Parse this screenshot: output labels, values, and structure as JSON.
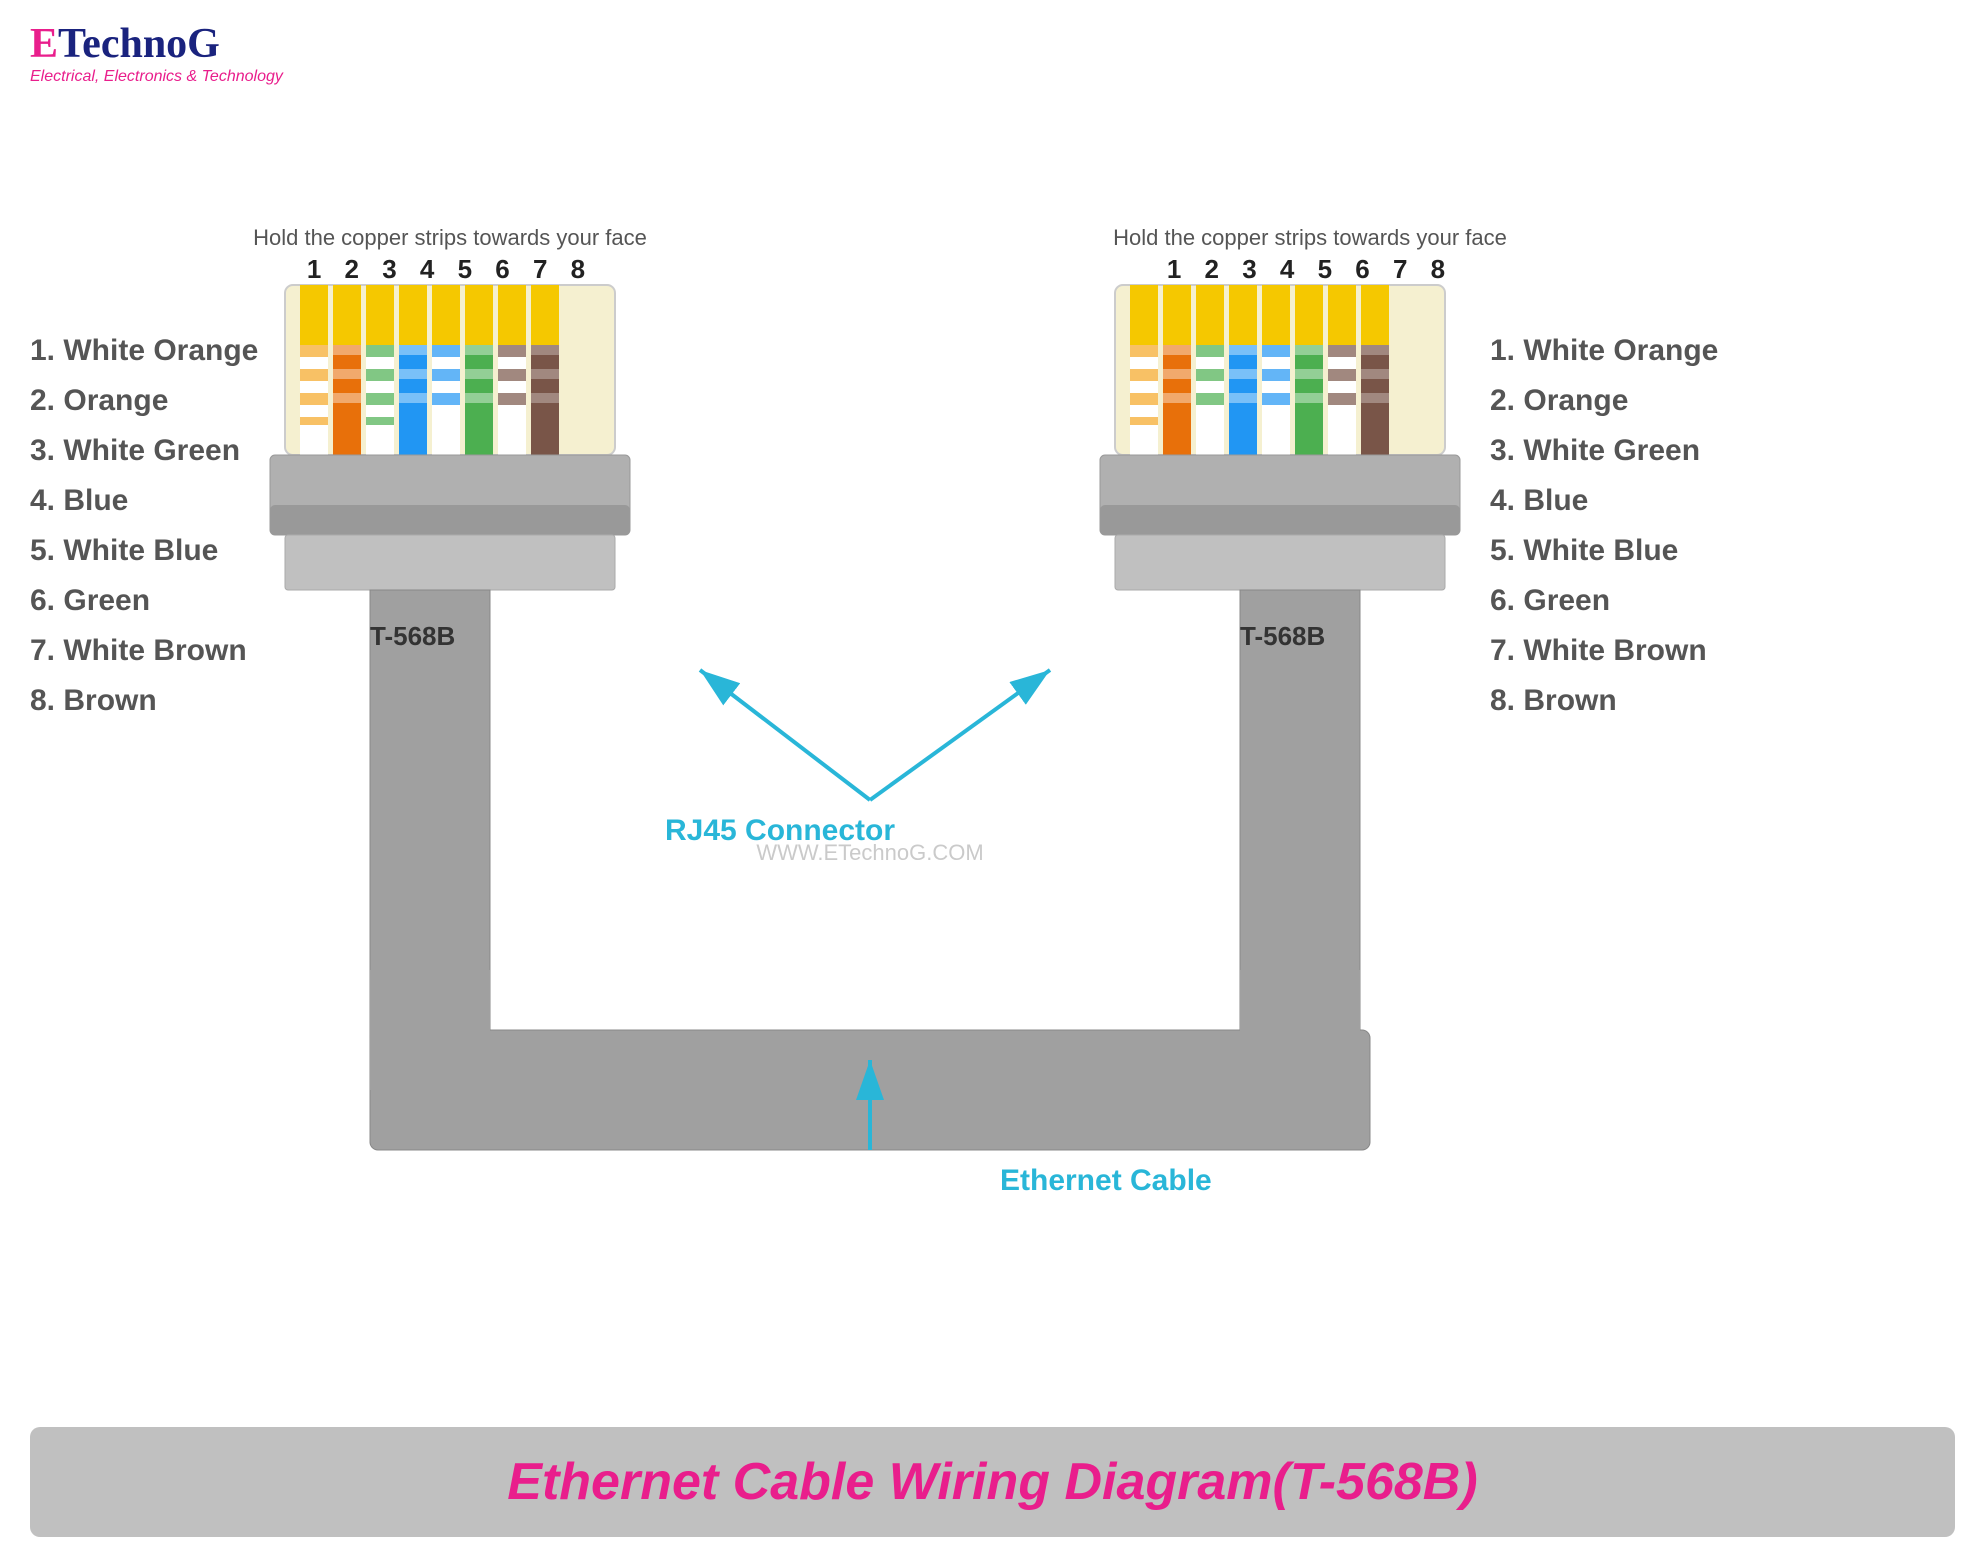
{
  "logo": {
    "e": "E",
    "technog": "TechnoG",
    "tagline": "Electrical, Electronics & Technology"
  },
  "instruction": "Hold the copper strips towards your face",
  "pin_numbers": "1 2 3 4 5 6 7 8",
  "watermark": "WWW.ETechnoG.COM",
  "connector_label": "T-568B",
  "rj45_label": "RJ45 Connector",
  "ethernet_label": "Ethernet Cable",
  "wire_labels": [
    "1. White Orange",
    "2. Orange",
    "3. White Green",
    "4. Blue",
    "5. White Blue",
    "6. Green",
    "7. White Brown",
    "8. Brown"
  ],
  "diagram_title": "Ethernet Cable Wiring Diagram(T-568B)",
  "colors": {
    "accent": "#29b6d8",
    "pink": "#e91e8c",
    "dark_blue": "#1a237e",
    "wire_orange_white": "#f5a623",
    "wire_orange": "#e8700a",
    "wire_green_white": "#4caf50",
    "wire_blue": "#2196f3",
    "wire_brown": "#795548"
  }
}
